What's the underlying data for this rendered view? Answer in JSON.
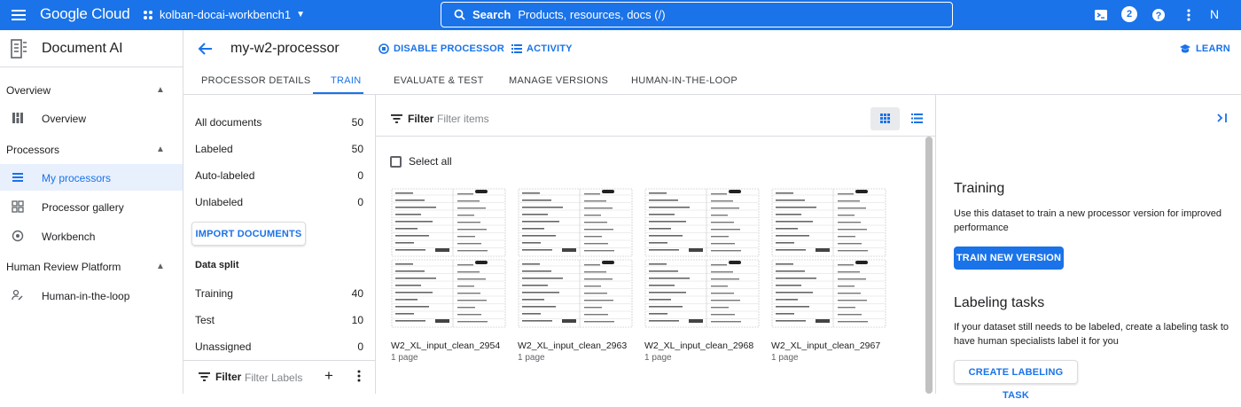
{
  "topbar": {
    "logo": "Google Cloud",
    "project": "kolban-docai-workbench1",
    "search_label": "Search",
    "search_placeholder": "Products, resources, docs (/)",
    "notifications_count": "2",
    "avatar_initial": "N"
  },
  "sidebar": {
    "title": "Document AI",
    "sections": [
      {
        "label": "Overview",
        "items": [
          "Overview"
        ]
      },
      {
        "label": "Processors",
        "items": [
          "My processors",
          "Processor gallery",
          "Workbench"
        ]
      },
      {
        "label": "Human Review Platform",
        "items": [
          "Human-in-the-loop"
        ]
      }
    ],
    "active_item": "My processors"
  },
  "header": {
    "title": "my-w2-processor",
    "disable_label": "DISABLE PROCESSOR",
    "activity_label": "ACTIVITY",
    "learn_label": "LEARN"
  },
  "tabs": [
    "PROCESSOR DETAILS",
    "TRAIN",
    "EVALUATE & TEST",
    "MANAGE VERSIONS",
    "HUMAN-IN-THE-LOOP"
  ],
  "active_tab": "TRAIN",
  "filters": {
    "rows": [
      {
        "label": "All documents",
        "count": "50"
      },
      {
        "label": "Labeled",
        "count": "50"
      },
      {
        "label": "Auto-labeled",
        "count": "0"
      },
      {
        "label": "Unlabeled",
        "count": "0"
      }
    ],
    "import_label": "IMPORT DOCUMENTS",
    "data_split_label": "Data split",
    "split_rows": [
      {
        "label": "Training",
        "count": "40"
      },
      {
        "label": "Test",
        "count": "10"
      },
      {
        "label": "Unassigned",
        "count": "0"
      }
    ],
    "filter_label": "Filter",
    "filter_placeholder": "Filter Labels"
  },
  "docs": {
    "filter_label": "Filter",
    "filter_placeholder": "Filter items",
    "select_all_label": "Select all",
    "cards": [
      {
        "name": "W2_XL_input_clean_2954",
        "pages": "1 page"
      },
      {
        "name": "W2_XL_input_clean_2963",
        "pages": "1 page"
      },
      {
        "name": "W2_XL_input_clean_2968",
        "pages": "1 page"
      },
      {
        "name": "W2_XL_input_clean_2967",
        "pages": "1 page"
      }
    ]
  },
  "right_panel": {
    "training_title": "Training",
    "training_desc": "Use this dataset to train a new processor version for improved performance",
    "train_button": "TRAIN NEW VERSION",
    "labeling_title": "Labeling tasks",
    "labeling_desc": "If your dataset still needs to be labeled, create a labeling task to have human specialists label it for you",
    "labeling_button": "CREATE LABELING TASK"
  },
  "colors": {
    "brand": "#1a73e8",
    "active_bg": "#e8f0fe",
    "border": "#dadce0"
  }
}
